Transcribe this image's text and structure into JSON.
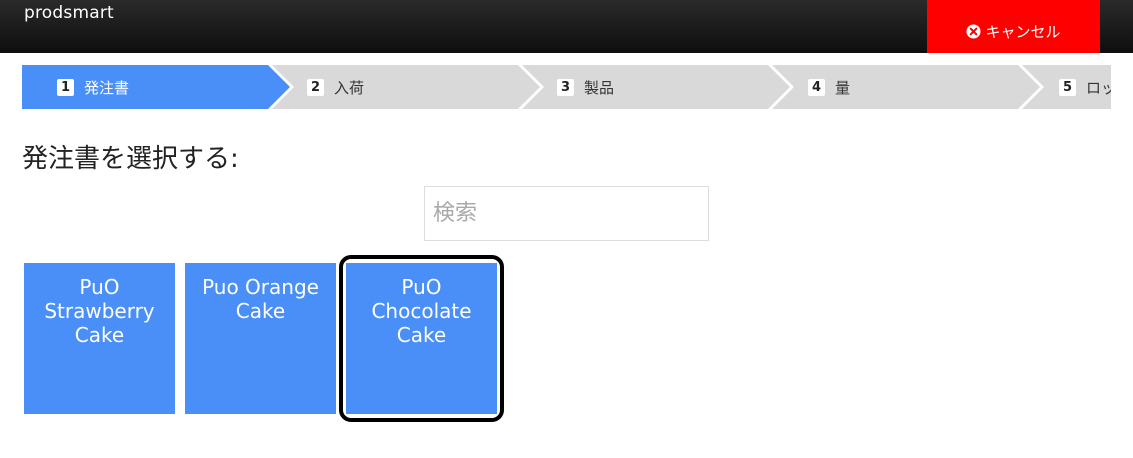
{
  "app": {
    "brand": "prodsmart"
  },
  "header": {
    "cancel_label": "キャンセル"
  },
  "steps": [
    {
      "num": "1",
      "label": "発注書",
      "active": true
    },
    {
      "num": "2",
      "label": "入荷",
      "active": false
    },
    {
      "num": "3",
      "label": "製品",
      "active": false
    },
    {
      "num": "4",
      "label": "量",
      "active": false
    },
    {
      "num": "5",
      "label": "ロット",
      "active": false
    }
  ],
  "main": {
    "heading": "発注書を選択する:",
    "search_placeholder": "検索",
    "cards": [
      {
        "label": "PuO Strawberry Cake",
        "selected": false
      },
      {
        "label": "Puo Orange Cake",
        "selected": false
      },
      {
        "label": "PuO Chocolate Cake",
        "selected": true
      }
    ]
  },
  "colors": {
    "topbar": "#1a1a1a",
    "cancel": "#ff0000",
    "step_active": "#4a8ff7",
    "step_inactive": "#d9d9d9",
    "card": "#4a8ff7"
  }
}
